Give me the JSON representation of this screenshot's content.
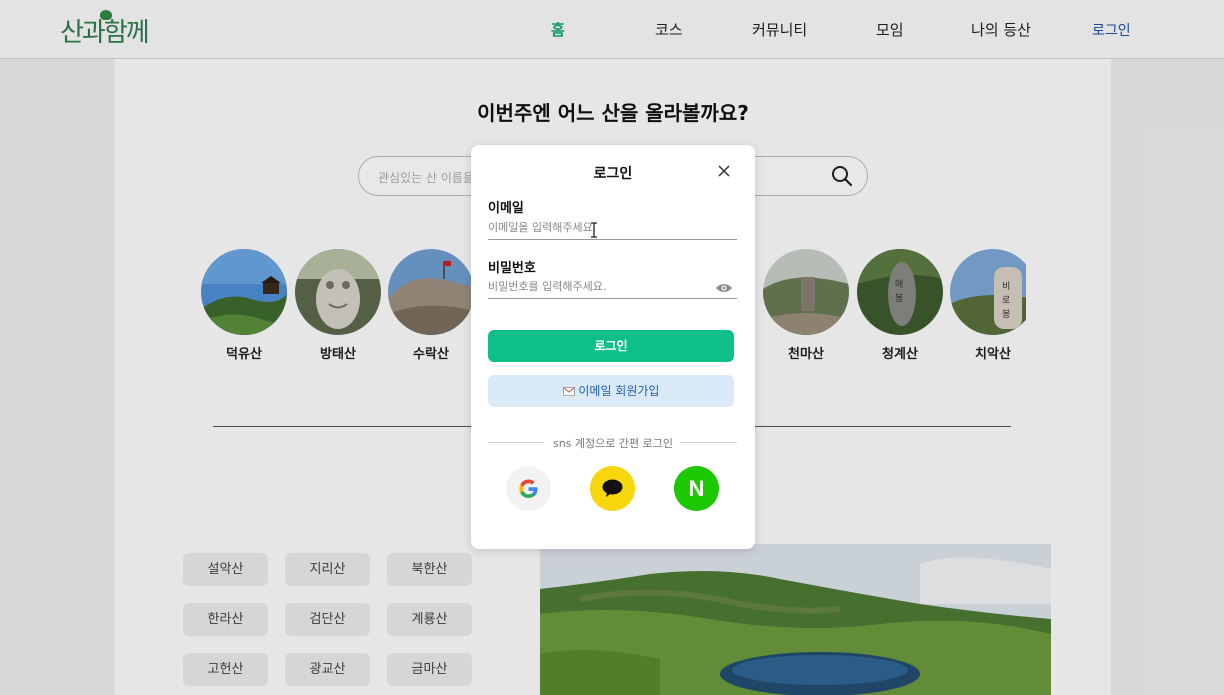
{
  "header": {
    "logo": "산과함께",
    "nav": [
      "홈",
      "코스",
      "커뮤니티",
      "모임",
      "나의 등산"
    ],
    "login": "로그인"
  },
  "main": {
    "headline": "이번주엔 어느 산을 올라볼까요?",
    "search_placeholder": "관심있는 산 이름을",
    "mountains": [
      "덕유산",
      "방태산",
      "수락산",
      "천마산",
      "청계산",
      "치악산"
    ],
    "tags": [
      "설악산",
      "지리산",
      "북한산",
      "한라산",
      "검단산",
      "계룡산",
      "고헌산",
      "광교산",
      "금마산"
    ]
  },
  "modal": {
    "title": "로그인",
    "email_label": "이메일",
    "email_placeholder": "이메일을 입력해주세요.",
    "password_label": "비밀번호",
    "password_placeholder": "비밀번호를 입력해주세요.",
    "login_button": "로그인",
    "signup_button": "이메일 회원가입",
    "sns_text": "sns 계정으로 간편 로그인",
    "naver_letter": "N"
  },
  "colors": {
    "primary": "#0fbf8a",
    "active_nav": "#10a86f",
    "login_link": "#1d4fa0",
    "kakao": "#f7d60c",
    "naver": "#1ec800"
  }
}
